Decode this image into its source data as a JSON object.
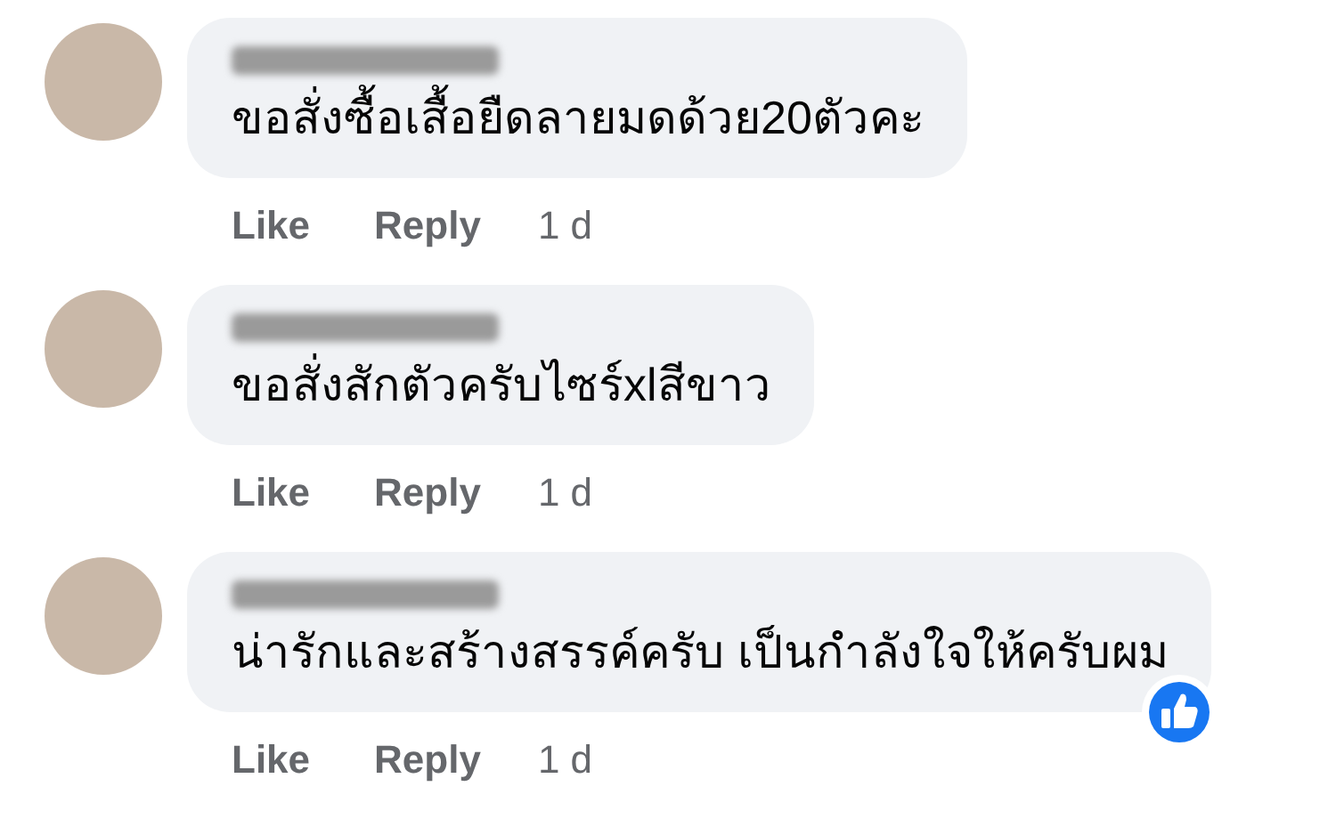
{
  "comments": [
    {
      "text": "ขอสั่งซื้อเสื้อยืดลายมดด้วย20ตัวคะ",
      "actions": [
        "Like",
        "Reply"
      ],
      "time": "1 d",
      "liked": false
    },
    {
      "text": "ขอสั่งสักตัวครับไซร์xlสีขาว",
      "actions": [
        "Like",
        "Reply"
      ],
      "time": "1 d",
      "liked": false
    },
    {
      "text": "น่ารักและสร้างสรรค์ครับ เป็นกำลังใจให้ครับผม",
      "actions": [
        "Like",
        "Reply"
      ],
      "time": "1 d",
      "liked": true
    }
  ]
}
